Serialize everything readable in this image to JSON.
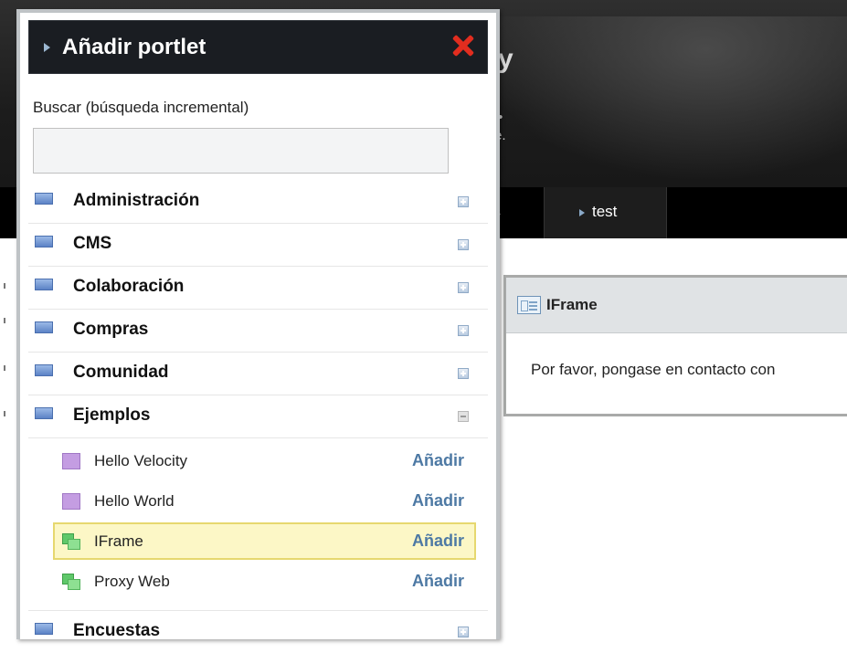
{
  "background": {
    "nav_tab_partial": "s",
    "nav_tab_test": "test",
    "header_fragment_e": "e.",
    "header_fragment_letter": "y",
    "iframe_portlet": {
      "title": "IFrame",
      "body_text": "Por favor, pongase en contacto con"
    }
  },
  "add_portlet_panel": {
    "title": "Añadir portlet",
    "search": {
      "label": "Buscar (búsqueda incremental)",
      "value": "",
      "placeholder": ""
    },
    "categories": [
      {
        "label": "Administración",
        "toggle": "plus"
      },
      {
        "label": "CMS",
        "toggle": "plus"
      },
      {
        "label": "Colaboración",
        "toggle": "plus"
      },
      {
        "label": "Compras",
        "toggle": "plus"
      },
      {
        "label": "Comunidad",
        "toggle": "plus"
      },
      {
        "label": "Ejemplos",
        "toggle": "minus",
        "expanded": true
      },
      {
        "label": "Encuestas",
        "toggle": "plus"
      }
    ],
    "ejemplos_portlets": [
      {
        "label": "Hello Velocity",
        "add_label": "Añadir",
        "icon": "purple-portlet-icon"
      },
      {
        "label": "Hello World",
        "add_label": "Añadir",
        "icon": "purple-portlet-icon"
      },
      {
        "label": "IFrame",
        "add_label": "Añadir",
        "icon": "green-portlet-icon",
        "selected": true
      },
      {
        "label": "Proxy Web",
        "add_label": "Añadir",
        "icon": "green-portlet-icon"
      }
    ]
  },
  "colors": {
    "panel_header_bg": "#1a1d22",
    "close_red": "#e22d1f",
    "add_link": "#4d79a4",
    "selected_row_bg": "#fcf7c6",
    "selected_row_border": "#e6d86f"
  }
}
